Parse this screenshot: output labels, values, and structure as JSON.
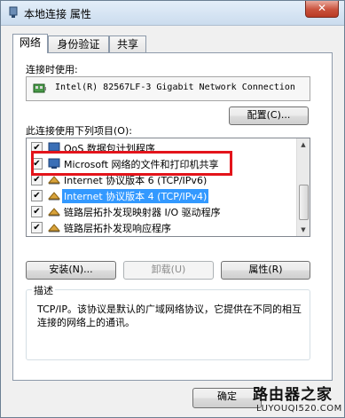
{
  "window": {
    "title": "本地连接 属性",
    "close_glyph": "✕"
  },
  "tabs": [
    {
      "label": "网络",
      "active": true
    },
    {
      "label": "身份验证",
      "active": false
    },
    {
      "label": "共享",
      "active": false
    }
  ],
  "connect_using": {
    "label": "连接时使用:",
    "adapter": "Intel(R) 82567LF-3 Gigabit Network Connection",
    "configure_button": "配置(C)..."
  },
  "items_section": {
    "label": "此连接使用下列项目(O):",
    "items": [
      {
        "label": "QoS 数据包计划程序",
        "checked": true,
        "icon": "qos-icon",
        "selected": false
      },
      {
        "label": "Microsoft 网络的文件和打印机共享",
        "checked": true,
        "icon": "share-icon",
        "selected": false
      },
      {
        "label": "Internet 协议版本 6 (TCP/IPv6)",
        "checked": true,
        "icon": "protocol-icon",
        "selected": false
      },
      {
        "label": "Internet 协议版本 4 (TCP/IPv4)",
        "checked": true,
        "icon": "protocol-icon",
        "selected": true
      },
      {
        "label": "链路层拓扑发现映射器 I/O 驱动程序",
        "checked": true,
        "icon": "protocol-icon",
        "selected": false
      },
      {
        "label": "链路层拓扑发现响应程序",
        "checked": true,
        "icon": "protocol-icon",
        "selected": false
      }
    ],
    "check_glyph": "✔"
  },
  "actions": {
    "install": "安装(N)...",
    "uninstall": "卸载(U)",
    "properties": "属性(R)"
  },
  "description": {
    "title": "描述",
    "text": "TCP/IP。该协议是默认的广域网络协议，它提供在不同的相互连接的网络上的通讯。"
  },
  "footer": {
    "ok": "确定"
  },
  "watermark": {
    "main": "路由器之家",
    "sub": "LUYOUQI520.COM"
  },
  "colors": {
    "highlight_border": "#e3141b",
    "selection": "#3399ff"
  }
}
